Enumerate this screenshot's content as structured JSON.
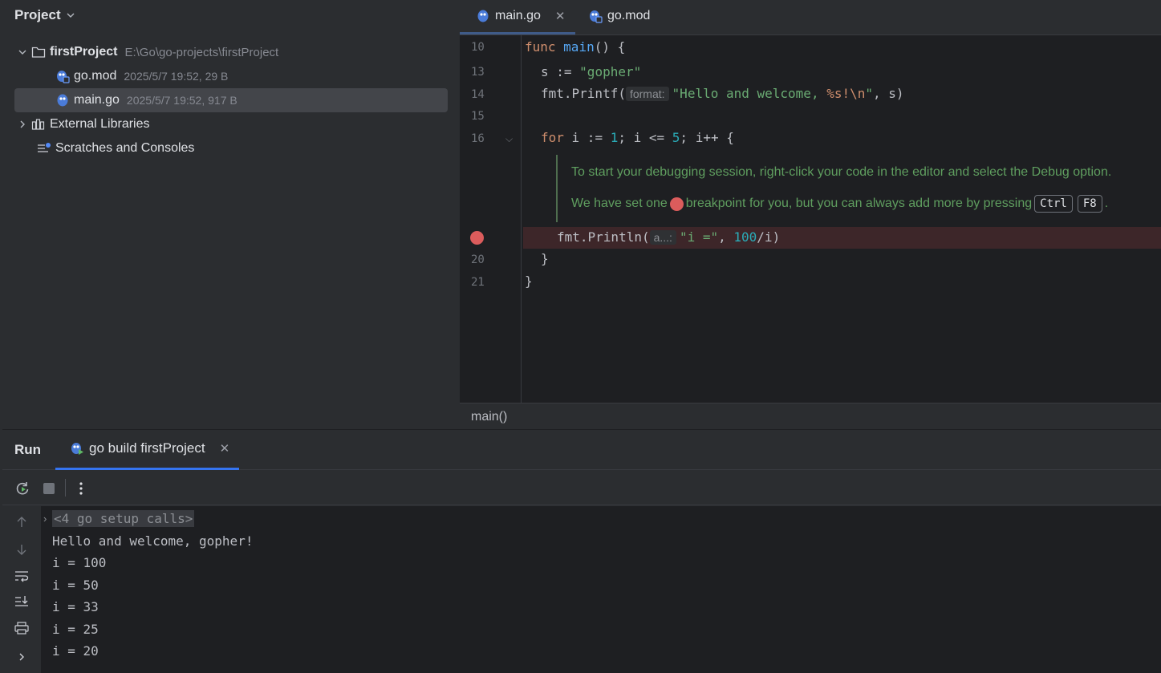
{
  "project": {
    "title": "Project",
    "root": {
      "name": "firstProject",
      "path": "E:\\Go\\go-projects\\firstProject"
    },
    "files": [
      {
        "name": "go.mod",
        "meta": "2025/5/7 19:52, 29 B"
      },
      {
        "name": "main.go",
        "meta": "2025/5/7 19:52, 917 B"
      }
    ],
    "external_libraries": "External Libraries",
    "scratches": "Scratches and Consoles"
  },
  "editor": {
    "tabs": [
      {
        "label": "main.go",
        "active": true
      },
      {
        "label": "go.mod",
        "active": false
      }
    ],
    "line_numbers": [
      "10",
      "13",
      "14",
      "15",
      "16",
      "20",
      "21"
    ],
    "code": {
      "l10_kw": "func",
      "l10_fn": "main",
      "l10_rest": "() {",
      "l13_var": "s := ",
      "l13_str": "\"gopher\"",
      "l14_pkg": "fmt.",
      "l14_fn": "Printf(",
      "l14_hint": "format:",
      "l14_str1": "\"Hello and welcome, ",
      "l14_fmt": "%s!\\n",
      "l14_str2": "\"",
      "l14_rest": ", s)",
      "l16_kw": "for",
      "l16_a": " i := ",
      "l16_n1": "1",
      "l16_b": "; i <= ",
      "l16_n2": "5",
      "l16_c": "; i++ {",
      "l19_pkg": "fmt.",
      "l19_fn": "Println(",
      "l19_hint": "a...:",
      "l19_str": "\"i =\"",
      "l19_mid": ", ",
      "l19_num": "100",
      "l19_rest": "/i)",
      "l20": "}",
      "l21": "}"
    },
    "tip_line1": "To start your debugging session, right-click your code in the editor and select the Debug option.",
    "tip_line2_a": "We have set one",
    "tip_line2_b": "breakpoint for you, but you can always add more by pressing",
    "tip_key1": "Ctrl",
    "tip_key2": "F8",
    "tip_end": ".",
    "breadcrumb": "main()"
  },
  "run": {
    "title": "Run",
    "tab_label": "go build firstProject",
    "console": {
      "setup_calls": "<4 go setup calls>",
      "lines": [
        "Hello and welcome, gopher!",
        "i = 100",
        "i = 50",
        "i = 33",
        "i = 25",
        "i = 20"
      ]
    }
  },
  "colors": {
    "accent": "#3574f0",
    "breakpoint": "#db5c5c",
    "background": "#1e1f22",
    "panel": "#2b2d30"
  }
}
